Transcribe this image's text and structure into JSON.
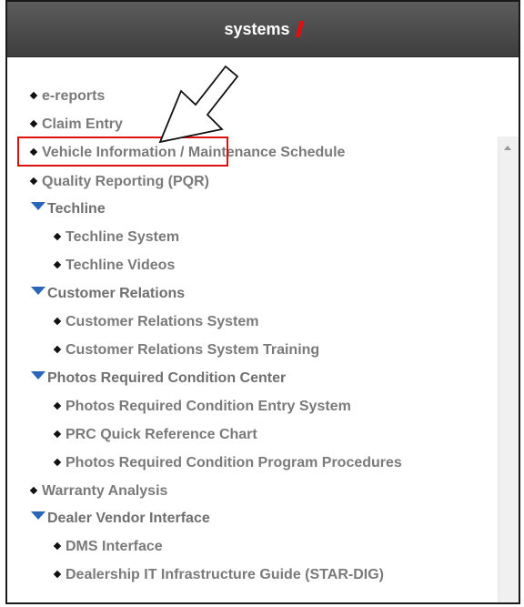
{
  "header": {
    "title": "systems"
  },
  "menu": {
    "items": [
      {
        "label": "e-reports"
      },
      {
        "label": "Claim Entry"
      },
      {
        "label": "Vehicle Information / Maintenance Schedule"
      },
      {
        "label": "Quality Reporting (PQR)"
      },
      {
        "label": "Techline"
      },
      {
        "label": "Techline System"
      },
      {
        "label": "Techline Videos"
      },
      {
        "label": "Customer Relations"
      },
      {
        "label": "Customer Relations System"
      },
      {
        "label": "Customer Relations System Training"
      },
      {
        "label": "Photos Required Condition Center"
      },
      {
        "label": "Photos Required Condition Entry System"
      },
      {
        "label": "PRC Quick Reference Chart"
      },
      {
        "label": "Photos Required Condition Program Procedures"
      },
      {
        "label": "Warranty Analysis"
      },
      {
        "label": "Dealer Vendor Interface"
      },
      {
        "label": "DMS Interface"
      },
      {
        "label": "Dealership IT Infrastructure Guide (STAR-DIG)"
      }
    ]
  },
  "colors": {
    "accent": "#e01010",
    "section_marker": "#2a66b8",
    "header_bg": "#4a4a4a",
    "link": "#7a7a7a"
  },
  "icons": {
    "bullet": "diamond-bullet-icon",
    "section": "triangle-down-icon",
    "annotation": "arrow-pointer-icon"
  }
}
